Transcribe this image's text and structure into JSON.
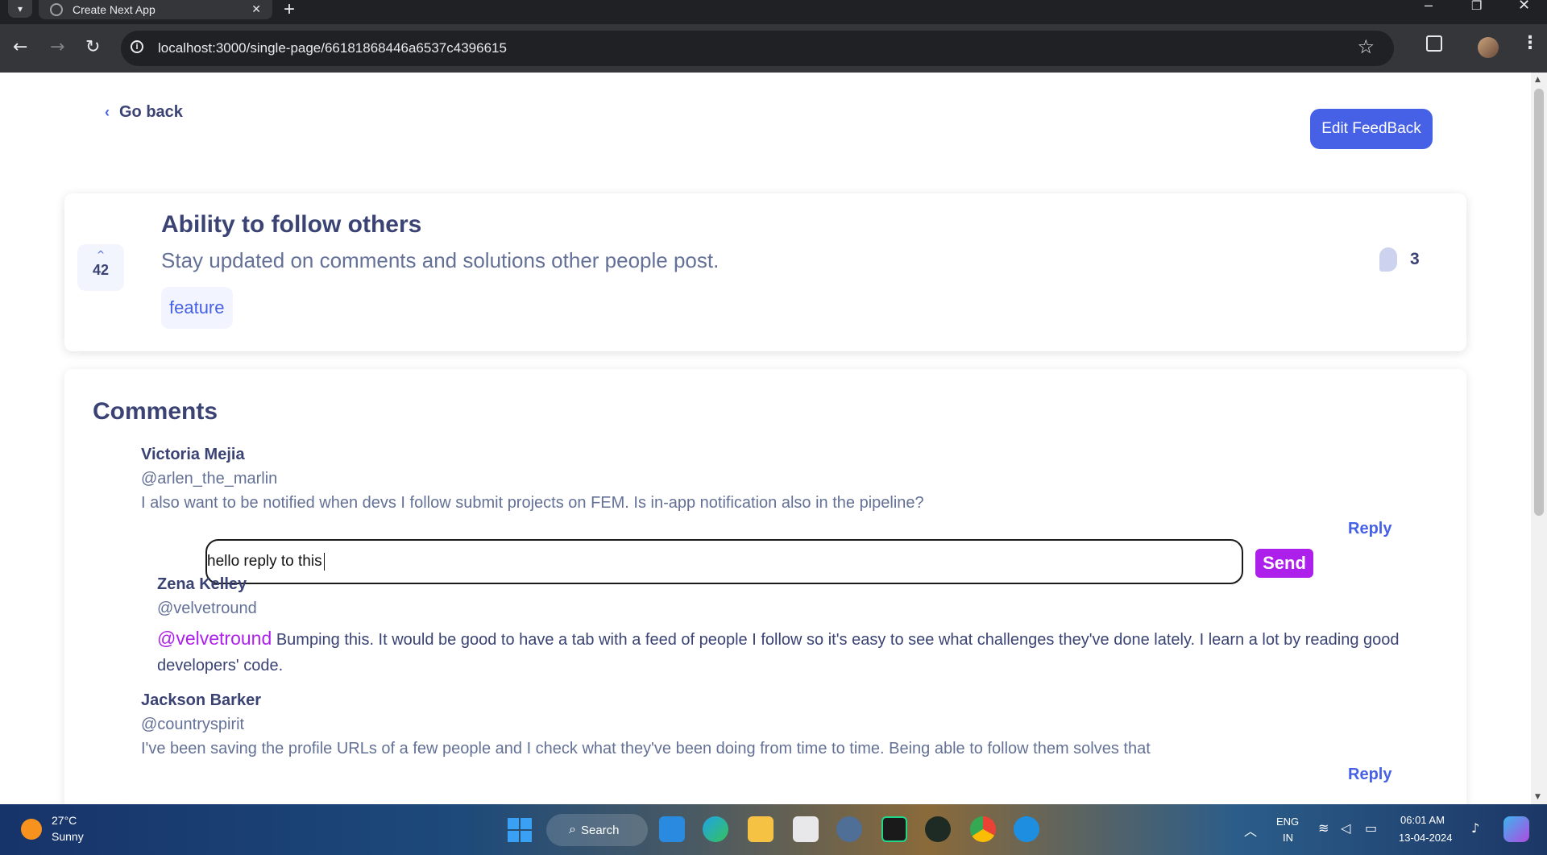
{
  "browser": {
    "tab_title": "Create Next App",
    "url": "localhost:3000/single-page/66181868446a6537c4396615"
  },
  "header": {
    "back_label": "Go back",
    "edit_label": "Edit FeedBack"
  },
  "feedback": {
    "upvotes": "42",
    "title": "Ability to follow others",
    "description": "Stay updated on comments and solutions other people post.",
    "category": "feature",
    "comment_count": "3"
  },
  "comments": {
    "heading": "Comments",
    "reply_label": "Reply",
    "send_label": "Send",
    "reply_input_value": "hello reply to this ",
    "items": [
      {
        "name": "Victoria Mejia",
        "handle": "@arlen_the_marlin",
        "text": "I also want to be notified when devs I follow submit projects on FEM. Is in-app notification also in the pipeline?",
        "replies": [
          {
            "name": "Zena Kelley",
            "handle": "@velvetround",
            "mention": "@velvetround",
            "text": " Bumping this. It would be good to have a tab with a feed of people I follow so it's easy to see what challenges they've done lately. I learn a lot by reading good developers' code."
          }
        ]
      },
      {
        "name": "Jackson Barker",
        "handle": "@countryspirit",
        "text": "I've been saving the profile URLs of a few people and I check what they've been doing from time to time. Being able to follow them solves that"
      }
    ]
  },
  "taskbar": {
    "temperature": "27°C",
    "condition": "Sunny",
    "search_label": "Search",
    "lang_top": "ENG",
    "lang_bottom": "IN",
    "time": "06:01 AM",
    "date": "13-04-2024"
  },
  "colors": {
    "primary": "#4661e6",
    "accent": "#ad1fea",
    "heading": "#3a4374",
    "muted": "#647196"
  }
}
